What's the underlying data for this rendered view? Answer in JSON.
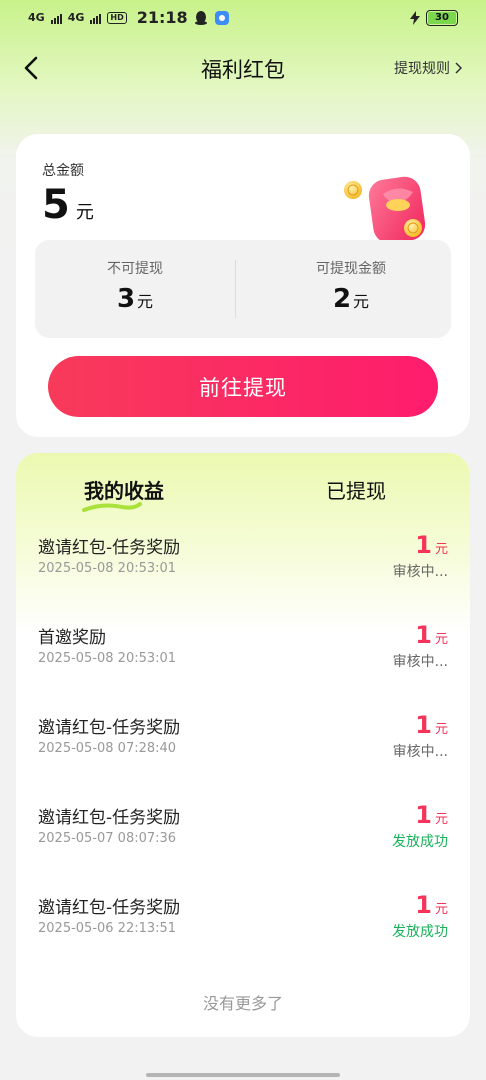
{
  "status_bar": {
    "network_1": "4G",
    "network_2": "4G",
    "hd": "HD",
    "time": "21:18",
    "battery": "30"
  },
  "header": {
    "title": "福利红包",
    "rules_link": "提现规则"
  },
  "summary": {
    "total_label": "总金额",
    "total_value": "5",
    "total_unit": "元",
    "not_withdrawable_label": "不可提现",
    "not_withdrawable_value": "3",
    "not_withdrawable_unit": "元",
    "withdrawable_label": "可提现金额",
    "withdrawable_value": "2",
    "withdrawable_unit": "元",
    "withdraw_button": "前往提现"
  },
  "tabs": {
    "my_earnings": "我的收益",
    "withdrawn": "已提现",
    "active": "my_earnings"
  },
  "records": [
    {
      "title": "邀请红包-任务奖励",
      "time": "2025-05-08 20:53:01",
      "amount": "1",
      "unit": "元",
      "status": "审核中...",
      "status_type": "pending"
    },
    {
      "title": "首邀奖励",
      "time": "2025-05-08 20:53:01",
      "amount": "1",
      "unit": "元",
      "status": "审核中...",
      "status_type": "pending"
    },
    {
      "title": "邀请红包-任务奖励",
      "time": "2025-05-08 07:28:40",
      "amount": "1",
      "unit": "元",
      "status": "审核中...",
      "status_type": "pending"
    },
    {
      "title": "邀请红包-任务奖励",
      "time": "2025-05-07 08:07:36",
      "amount": "1",
      "unit": "元",
      "status": "发放成功",
      "status_type": "success"
    },
    {
      "title": "邀请红包-任务奖励",
      "time": "2025-05-06 22:13:51",
      "amount": "1",
      "unit": "元",
      "status": "发放成功",
      "status_type": "success"
    }
  ],
  "no_more": "没有更多了",
  "colors": {
    "accent": "#fe2c5e",
    "success": "#19b25a",
    "header_bg": "#c8f28a"
  }
}
